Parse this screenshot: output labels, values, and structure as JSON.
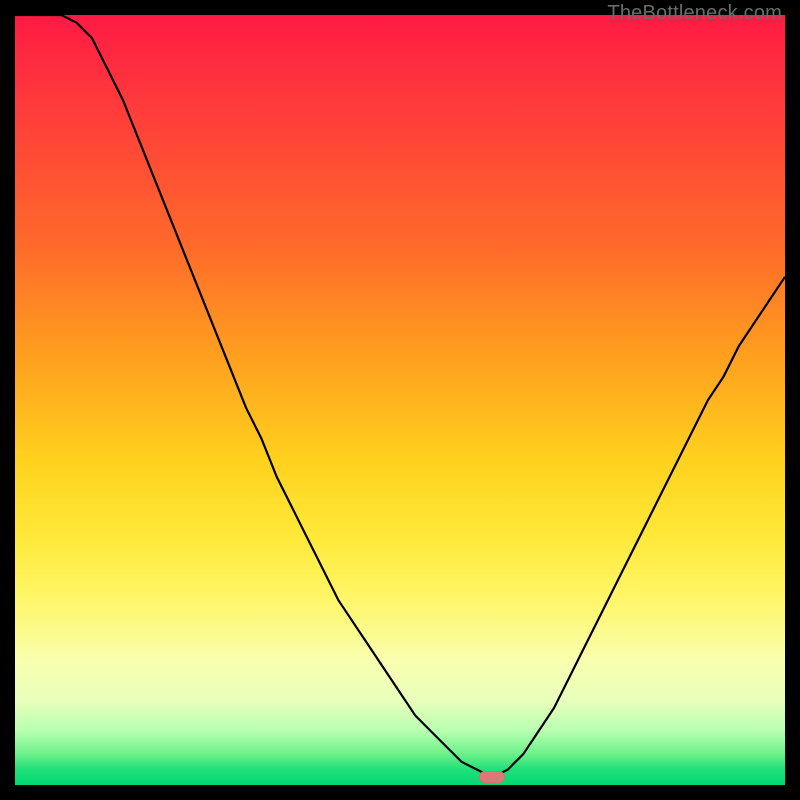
{
  "watermark": "TheBottleneck.com",
  "colors": {
    "frame": "#000000",
    "curve": "#000000",
    "marker": "#d97a78",
    "gradient_top": "#ff1a44",
    "gradient_mid1": "#ffa21e",
    "gradient_mid2": "#ffe93a",
    "gradient_bottom": "#00d870"
  },
  "chart_data": {
    "type": "line",
    "title": "",
    "xlabel": "",
    "ylabel": "",
    "xlim": [
      0,
      100
    ],
    "ylim": [
      0,
      100
    ],
    "x": [
      0,
      2,
      4,
      6,
      8,
      10,
      12,
      14,
      16,
      18,
      20,
      22,
      24,
      26,
      28,
      30,
      32,
      34,
      36,
      38,
      40,
      42,
      44,
      46,
      48,
      50,
      52,
      54,
      56,
      58,
      60,
      62,
      64,
      66,
      68,
      70,
      72,
      74,
      76,
      78,
      80,
      82,
      84,
      86,
      88,
      90,
      92,
      94,
      96,
      98,
      100
    ],
    "values": [
      100,
      100,
      100,
      100,
      99,
      97,
      93,
      89,
      84,
      79,
      74,
      69,
      64,
      59,
      54,
      49,
      45,
      40,
      36,
      32,
      28,
      24,
      21,
      18,
      15,
      12,
      9,
      7,
      5,
      3,
      2,
      1,
      2,
      4,
      7,
      10,
      14,
      18,
      22,
      26,
      30,
      34,
      38,
      42,
      46,
      50,
      53,
      57,
      60,
      63,
      66
    ],
    "trough": {
      "x": 62,
      "y": 1
    },
    "series_name": "bottleneck-curve",
    "annotations": [
      {
        "kind": "marker",
        "x": 62,
        "y": 1,
        "label": ""
      }
    ],
    "grid": false,
    "legend": false
  }
}
